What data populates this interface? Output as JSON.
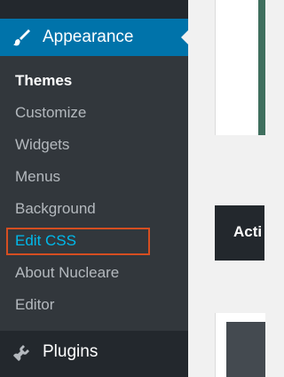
{
  "sidebar": {
    "active_menu": {
      "label": "Appearance",
      "icon": "paintbrush-icon"
    },
    "submenu": [
      {
        "label": "Themes",
        "state": "current"
      },
      {
        "label": "Customize",
        "state": "normal"
      },
      {
        "label": "Widgets",
        "state": "normal"
      },
      {
        "label": "Menus",
        "state": "normal"
      },
      {
        "label": "Background",
        "state": "normal"
      },
      {
        "label": "Edit CSS",
        "state": "highlighted"
      },
      {
        "label": "About Nucleare",
        "state": "normal"
      },
      {
        "label": "Editor",
        "state": "normal"
      }
    ],
    "next_menu": {
      "label": "Plugins",
      "icon": "plug-icon"
    }
  },
  "content": {
    "theme_bar_label": "Acti"
  },
  "colors": {
    "sidebar_bg": "#23282d",
    "submenu_bg": "#32373c",
    "active_bg": "#0073aa",
    "highlight_text": "#00b9eb",
    "highlight_border": "#d54e21"
  }
}
